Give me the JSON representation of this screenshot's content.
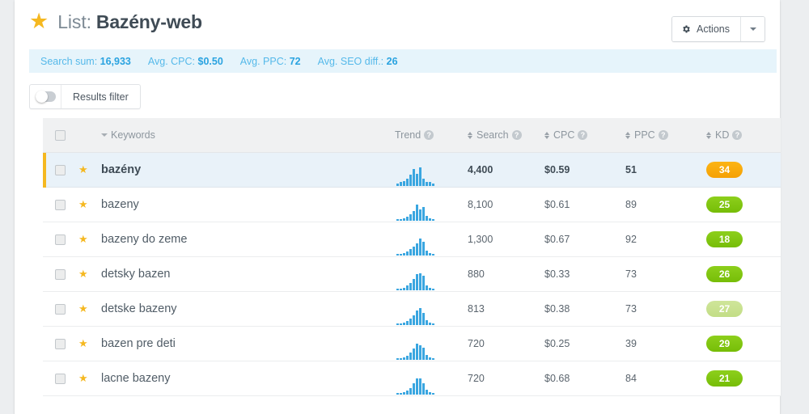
{
  "header": {
    "star_icon": "star-icon",
    "title_prefix": "List:",
    "title_name": "Bazény-web",
    "actions_label": "Actions"
  },
  "stats": [
    {
      "label": "Search sum:",
      "value": "16,933"
    },
    {
      "label": "Avg. CPC:",
      "value": "$0.50"
    },
    {
      "label": "Avg. PPC:",
      "value": "72"
    },
    {
      "label": "Avg. SEO diff.:",
      "value": "26"
    }
  ],
  "toolbar": {
    "filter_label": "Results filter",
    "filter_enabled": false
  },
  "table": {
    "columns": {
      "keywords": "Keywords",
      "trend": "Trend",
      "search": "Search",
      "cpc": "CPC",
      "ppc": "PPC",
      "kd": "KD"
    },
    "help_glyph": "?",
    "rows": [
      {
        "keyword": "bazény",
        "search": "4,400",
        "cpc": "$0.59",
        "ppc": "51",
        "kd": "34",
        "kd_color": "amber",
        "highlight": true,
        "trend": [
          2,
          3,
          4,
          6,
          9,
          14,
          10,
          15,
          6,
          3,
          3,
          2
        ]
      },
      {
        "keyword": "bazeny",
        "search": "8,100",
        "cpc": "$0.61",
        "ppc": "89",
        "kd": "25",
        "kd_color": "green",
        "highlight": false,
        "trend": [
          1,
          1,
          2,
          3,
          5,
          8,
          13,
          9,
          11,
          4,
          2,
          1
        ]
      },
      {
        "keyword": "bazeny do zeme",
        "search": "1,300",
        "cpc": "$0.67",
        "ppc": "92",
        "kd": "18",
        "kd_color": "green",
        "highlight": false,
        "trend": [
          1,
          1,
          2,
          3,
          5,
          7,
          10,
          14,
          11,
          4,
          2,
          1
        ]
      },
      {
        "keyword": "detsky bazen",
        "search": "880",
        "cpc": "$0.33",
        "ppc": "73",
        "kd": "26",
        "kd_color": "green",
        "highlight": false,
        "trend": [
          1,
          1,
          2,
          4,
          6,
          9,
          13,
          14,
          12,
          4,
          2,
          1
        ]
      },
      {
        "keyword": "detske bazeny",
        "search": "813",
        "cpc": "$0.38",
        "ppc": "73",
        "kd": "27",
        "kd_color": "pale",
        "highlight": false,
        "trend": [
          1,
          1,
          2,
          3,
          5,
          8,
          12,
          14,
          10,
          4,
          2,
          1
        ]
      },
      {
        "keyword": "bazen pre deti",
        "search": "720",
        "cpc": "$0.25",
        "ppc": "39",
        "kd": "29",
        "kd_color": "green",
        "highlight": false,
        "trend": [
          1,
          1,
          2,
          3,
          6,
          9,
          13,
          12,
          10,
          4,
          2,
          1
        ]
      },
      {
        "keyword": "lacne bazeny",
        "search": "720",
        "cpc": "$0.68",
        "ppc": "84",
        "kd": "21",
        "kd_color": "green",
        "highlight": false,
        "trend": [
          1,
          1,
          2,
          3,
          5,
          9,
          13,
          13,
          9,
          4,
          2,
          1
        ]
      }
    ]
  },
  "colors": {
    "accent_blue": "#2aa3e0",
    "accent_amber": "#f5b820",
    "kd_green": "#7ac70c",
    "kd_pale": "#c6e08e",
    "kd_amber": "#f5a105"
  }
}
